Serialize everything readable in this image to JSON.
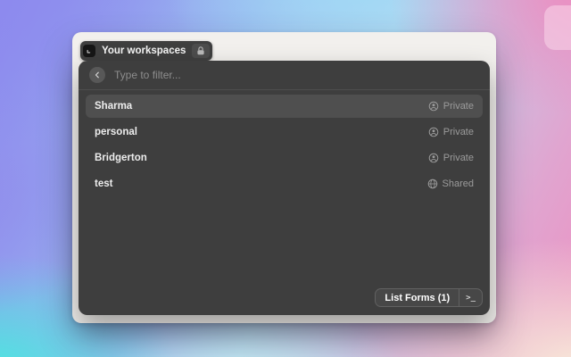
{
  "app": {
    "trigger": {
      "label": "Your workspaces"
    },
    "filter": {
      "placeholder": "Type to filter..."
    },
    "workspaces": [
      {
        "name": "Sharma",
        "visibility": "Private",
        "selected": true
      },
      {
        "name": "personal",
        "visibility": "Private",
        "selected": false
      },
      {
        "name": "Bridgerton",
        "visibility": "Private",
        "selected": false
      },
      {
        "name": "test",
        "visibility": "Shared",
        "selected": false
      }
    ],
    "footer": {
      "action_label": "List Forms (1)",
      "terminal_glyph": ">_"
    }
  },
  "icons": {
    "trigger_left": "app-icon",
    "trigger_right": "lock-icon",
    "filter_back": "chevron-left-icon",
    "private": "user-circle-icon",
    "shared": "globe-icon",
    "footer_right": "terminal-prompt-icon"
  },
  "colors": {
    "panel_bg": "#3e3e3e",
    "selected_row_bg": "#4f4f4f",
    "window_bg": "#f2f0ed",
    "muted_text": "#9b9b9b",
    "gradient_corners": {
      "top_left": "#8d8aee",
      "top_center": "#9edaf5",
      "top_right": "#eb8ec1",
      "bottom_left": "#4ce6e0",
      "bottom_right": "#f8ecda"
    }
  }
}
